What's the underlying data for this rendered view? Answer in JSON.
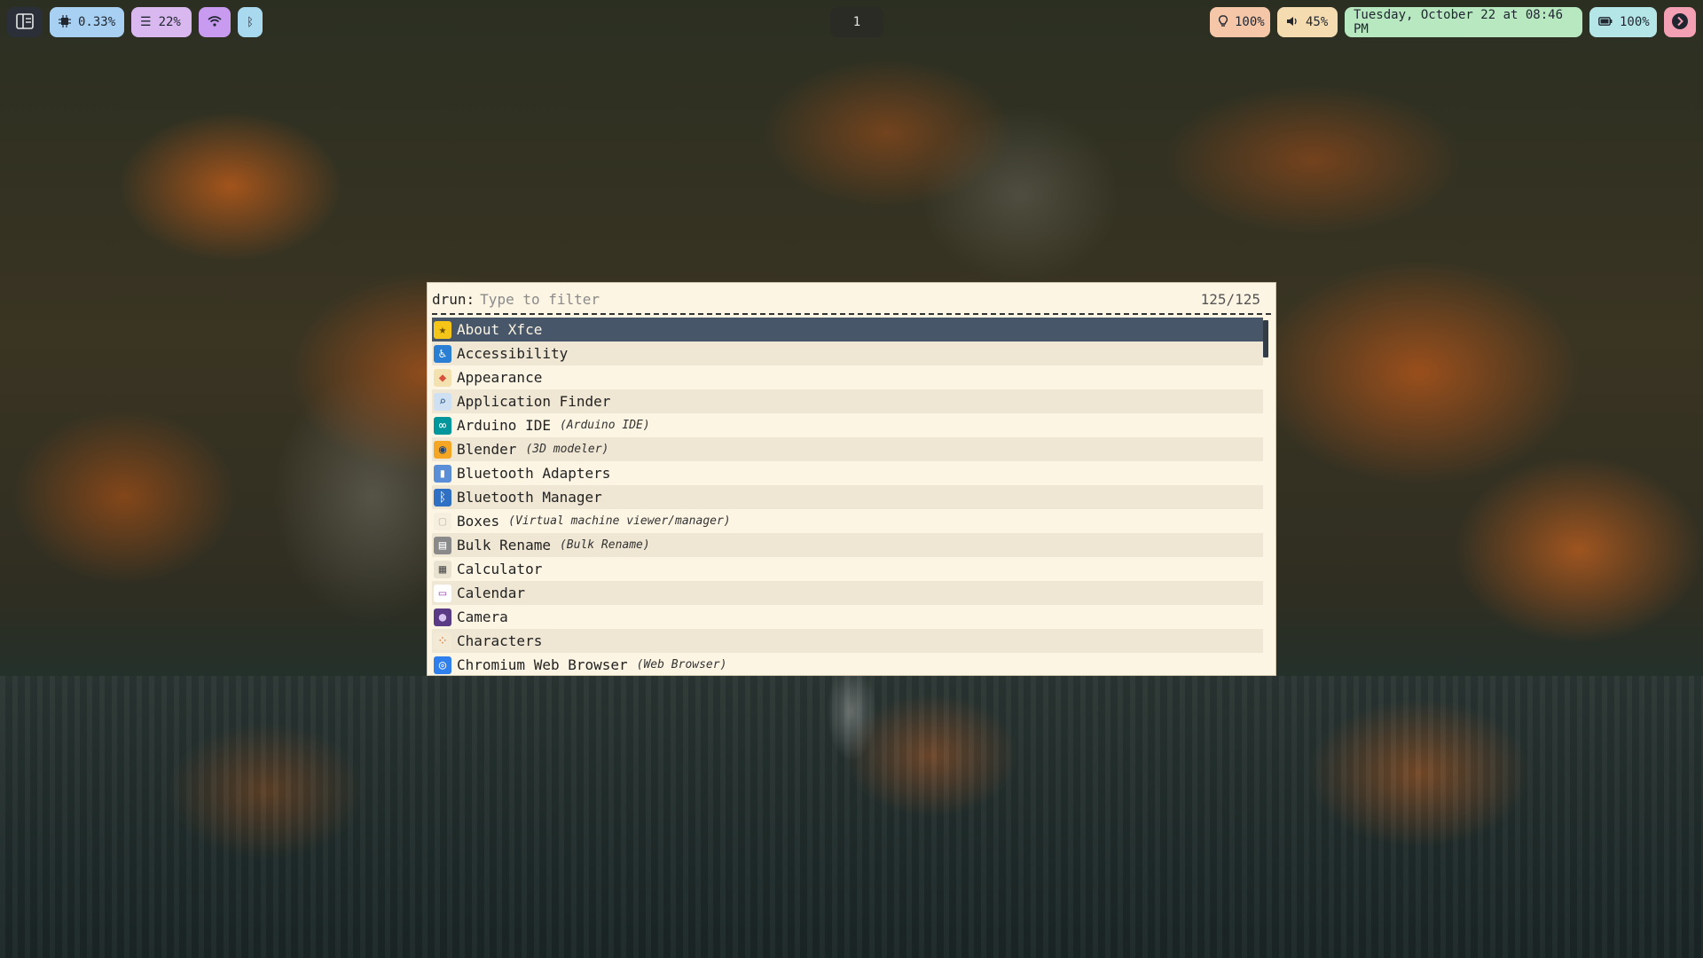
{
  "topbar": {
    "cpu": "0.33%",
    "memory": "22%",
    "workspace": "1",
    "brightness": "100%",
    "volume": "45%",
    "datetime": "Tuesday, October 22 at 08:46 PM",
    "battery": "100%"
  },
  "rofi": {
    "prompt": "drun:",
    "placeholder": "Type to filter",
    "filter_value": "",
    "count": "125/125",
    "entries": [
      {
        "name": "About Xfce",
        "generic": "",
        "icon": "★",
        "icon_bg": "#f5c518",
        "icon_fg": "#6b4f00"
      },
      {
        "name": "Accessibility",
        "generic": "",
        "icon": "♿",
        "icon_bg": "#2a7fd4",
        "icon_fg": "#ffffff"
      },
      {
        "name": "Appearance",
        "generic": "",
        "icon": "◆",
        "icon_bg": "#f3e1b0",
        "icon_fg": "#d9513b"
      },
      {
        "name": "Application Finder",
        "generic": "",
        "icon": "⌕",
        "icon_bg": "#cfe0f2",
        "icon_fg": "#2a5d8f"
      },
      {
        "name": "Arduino IDE",
        "generic": "(Arduino IDE)",
        "icon": "∞",
        "icon_bg": "#00979c",
        "icon_fg": "#ffffff"
      },
      {
        "name": "Blender",
        "generic": "(3D modeler)",
        "icon": "◉",
        "icon_bg": "#f5a623",
        "icon_fg": "#24477b"
      },
      {
        "name": "Bluetooth Adapters",
        "generic": "",
        "icon": "▮",
        "icon_bg": "#5a8fd8",
        "icon_fg": "#ffffff"
      },
      {
        "name": "Bluetooth Manager",
        "generic": "",
        "icon": "ᛒ",
        "icon_bg": "#2f6fc4",
        "icon_fg": "#ffffff"
      },
      {
        "name": "Boxes",
        "generic": "(Virtual machine viewer/manager)",
        "icon": "▢",
        "icon_bg": "#f6efe0",
        "icon_fg": "#c9c0ad"
      },
      {
        "name": "Bulk Rename",
        "generic": "(Bulk Rename)",
        "icon": "▤",
        "icon_bg": "#8a8a8a",
        "icon_fg": "#ffffff"
      },
      {
        "name": "Calculator",
        "generic": "",
        "icon": "▦",
        "icon_bg": "#e9e2d0",
        "icon_fg": "#555555"
      },
      {
        "name": "Calendar",
        "generic": "",
        "icon": "▭",
        "icon_bg": "#ffffff",
        "icon_fg": "#9b59b6"
      },
      {
        "name": "Camera",
        "generic": "",
        "icon": "●",
        "icon_bg": "#5b3a86",
        "icon_fg": "#d7c4f0"
      },
      {
        "name": "Characters",
        "generic": "",
        "icon": "⁘",
        "icon_bg": "#f3ead6",
        "icon_fg": "#e06c2f"
      },
      {
        "name": "Chromium Web Browser",
        "generic": "(Web Browser)",
        "icon": "◎",
        "icon_bg": "#2f80ed",
        "icon_fg": "#ffffff"
      }
    ]
  },
  "colors": {
    "cpu_pill": "#a8d0f3",
    "memory_pill": "#d9b8f0",
    "wifi_pill": "#c89af0",
    "bluetooth_pill": "#a9d9ee",
    "brightness_pill": "#f6c6a8",
    "volume_pill": "#f4dcb0",
    "date_pill": "#b8e8c0",
    "battery_pill": "#b4e6e8",
    "power_pill": "#f4a0b4",
    "selected_bg": "#475668",
    "window_bg": "#fdf5e4"
  },
  "icons": {
    "launcher": "layout-icon",
    "cpu": "cpu-icon",
    "memory": "memory-icon",
    "wifi": "wifi-icon",
    "bluetooth": "bluetooth-icon",
    "brightness": "lightbulb-icon",
    "volume": "speaker-icon",
    "battery": "battery-icon",
    "power": "chevron-right-icon"
  }
}
